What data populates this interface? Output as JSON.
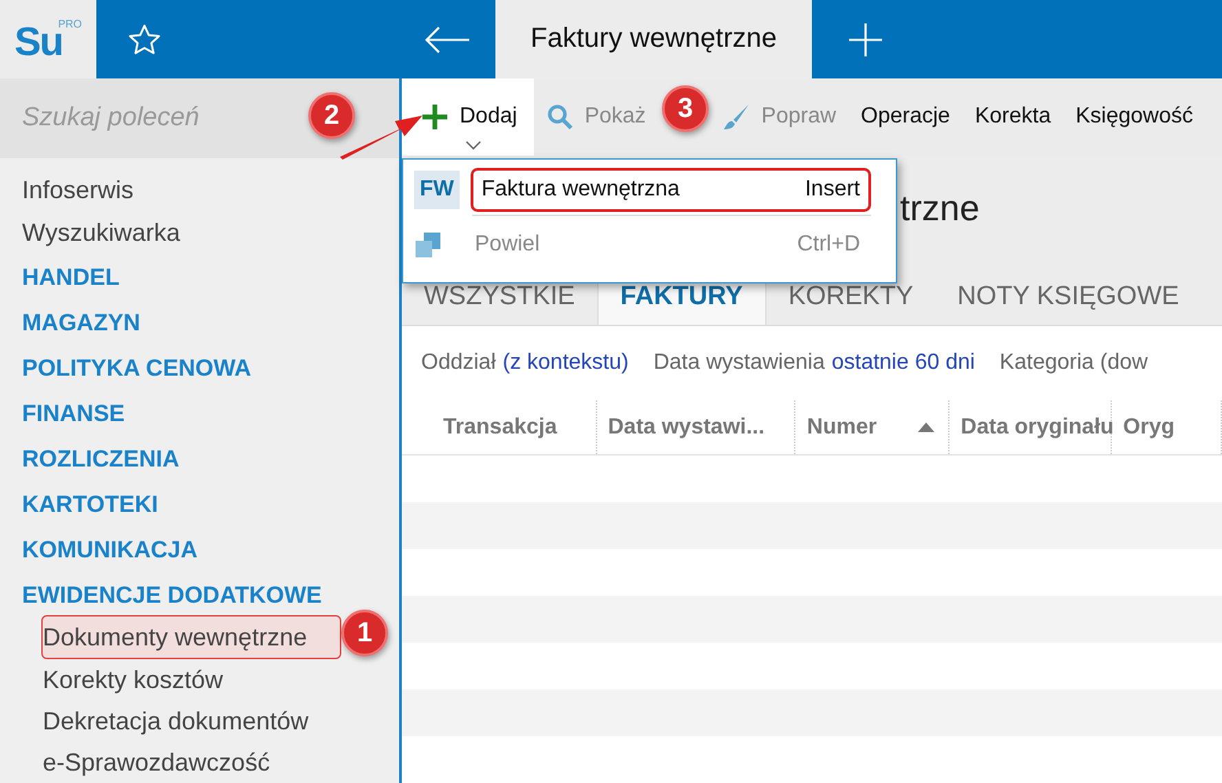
{
  "logo": {
    "text": "Su",
    "sup": "PRO"
  },
  "tabs": [
    {
      "label": "Faktury wewnętrzne",
      "selected": true
    }
  ],
  "search": {
    "placeholder": "Szukaj poleceń"
  },
  "toolbar": [
    {
      "label": "Dodaj",
      "kind": "plus",
      "disabled": false,
      "expanded": true
    },
    {
      "label": "Pokaż",
      "kind": "search",
      "disabled": true,
      "expanded": false
    },
    {
      "label": "Popraw",
      "kind": "brush",
      "disabled": true,
      "expanded": false
    },
    {
      "label": "Operacje",
      "kind": "text",
      "disabled": false,
      "expanded": false
    },
    {
      "label": "Korekta",
      "kind": "text",
      "disabled": false,
      "expanded": false
    },
    {
      "label": "Księgowość",
      "kind": "text",
      "disabled": false,
      "expanded": false
    }
  ],
  "sidebar": {
    "items": [
      {
        "label": "Infoserwis",
        "kind": "link",
        "selected": false
      },
      {
        "label": "Wyszukiwarka",
        "kind": "link",
        "selected": false
      },
      {
        "label": "HANDEL",
        "kind": "section",
        "selected": false
      },
      {
        "label": "MAGAZYN",
        "kind": "section",
        "selected": false
      },
      {
        "label": "POLITYKA CENOWA",
        "kind": "section",
        "selected": false
      },
      {
        "label": "FINANSE",
        "kind": "section",
        "selected": false
      },
      {
        "label": "ROZLICZENIA",
        "kind": "section",
        "selected": false
      },
      {
        "label": "KARTOTEKI",
        "kind": "section",
        "selected": false
      },
      {
        "label": "KOMUNIKACJA",
        "kind": "section",
        "selected": false
      },
      {
        "label": "EWIDENCJE DODATKOWE",
        "kind": "section",
        "selected": false
      },
      {
        "label": "Dokumenty wewnętrzne",
        "kind": "subitem",
        "selected": true
      },
      {
        "label": "Korekty kosztów",
        "kind": "subitem",
        "selected": false
      },
      {
        "label": "Dekretacja dokumentów",
        "kind": "subitem",
        "selected": false
      },
      {
        "label": "e-Sprawozdawczość",
        "kind": "subitem",
        "selected": false
      }
    ]
  },
  "page_title": "trzne",
  "dropdown": [
    {
      "badge": "FW",
      "label": "Faktura wewnętrzna",
      "shortcut": "Insert",
      "disabled": false,
      "selected": true
    },
    {
      "label": "Powiel",
      "shortcut": "Ctrl+D",
      "disabled": true,
      "selected": false
    }
  ],
  "doc_tabs": [
    {
      "label": "WSZYSTKIE",
      "selected": false
    },
    {
      "label": "FAKTURY",
      "selected": true
    },
    {
      "label": "KOREKTY",
      "selected": false
    },
    {
      "label": "NOTY KSIĘGOWE",
      "selected": false
    }
  ],
  "filters": [
    {
      "label": "Oddział",
      "value": "(z kontekstu)"
    },
    {
      "label": "Data wystawienia",
      "value": "ostatnie 60 dni"
    },
    {
      "label": "Kategoria (dow"
    }
  ],
  "table": {
    "columns": [
      {
        "label": "Transakcja",
        "sorted": false
      },
      {
        "label": "Data wystawi...",
        "sorted": false
      },
      {
        "label": "Numer",
        "sorted": true
      },
      {
        "label": "Data oryginału",
        "sorted": false
      },
      {
        "label": "Oryg",
        "sorted": false
      }
    ]
  },
  "annotations": [
    {
      "label": "1"
    },
    {
      "label": "2"
    },
    {
      "label": "3"
    }
  ]
}
